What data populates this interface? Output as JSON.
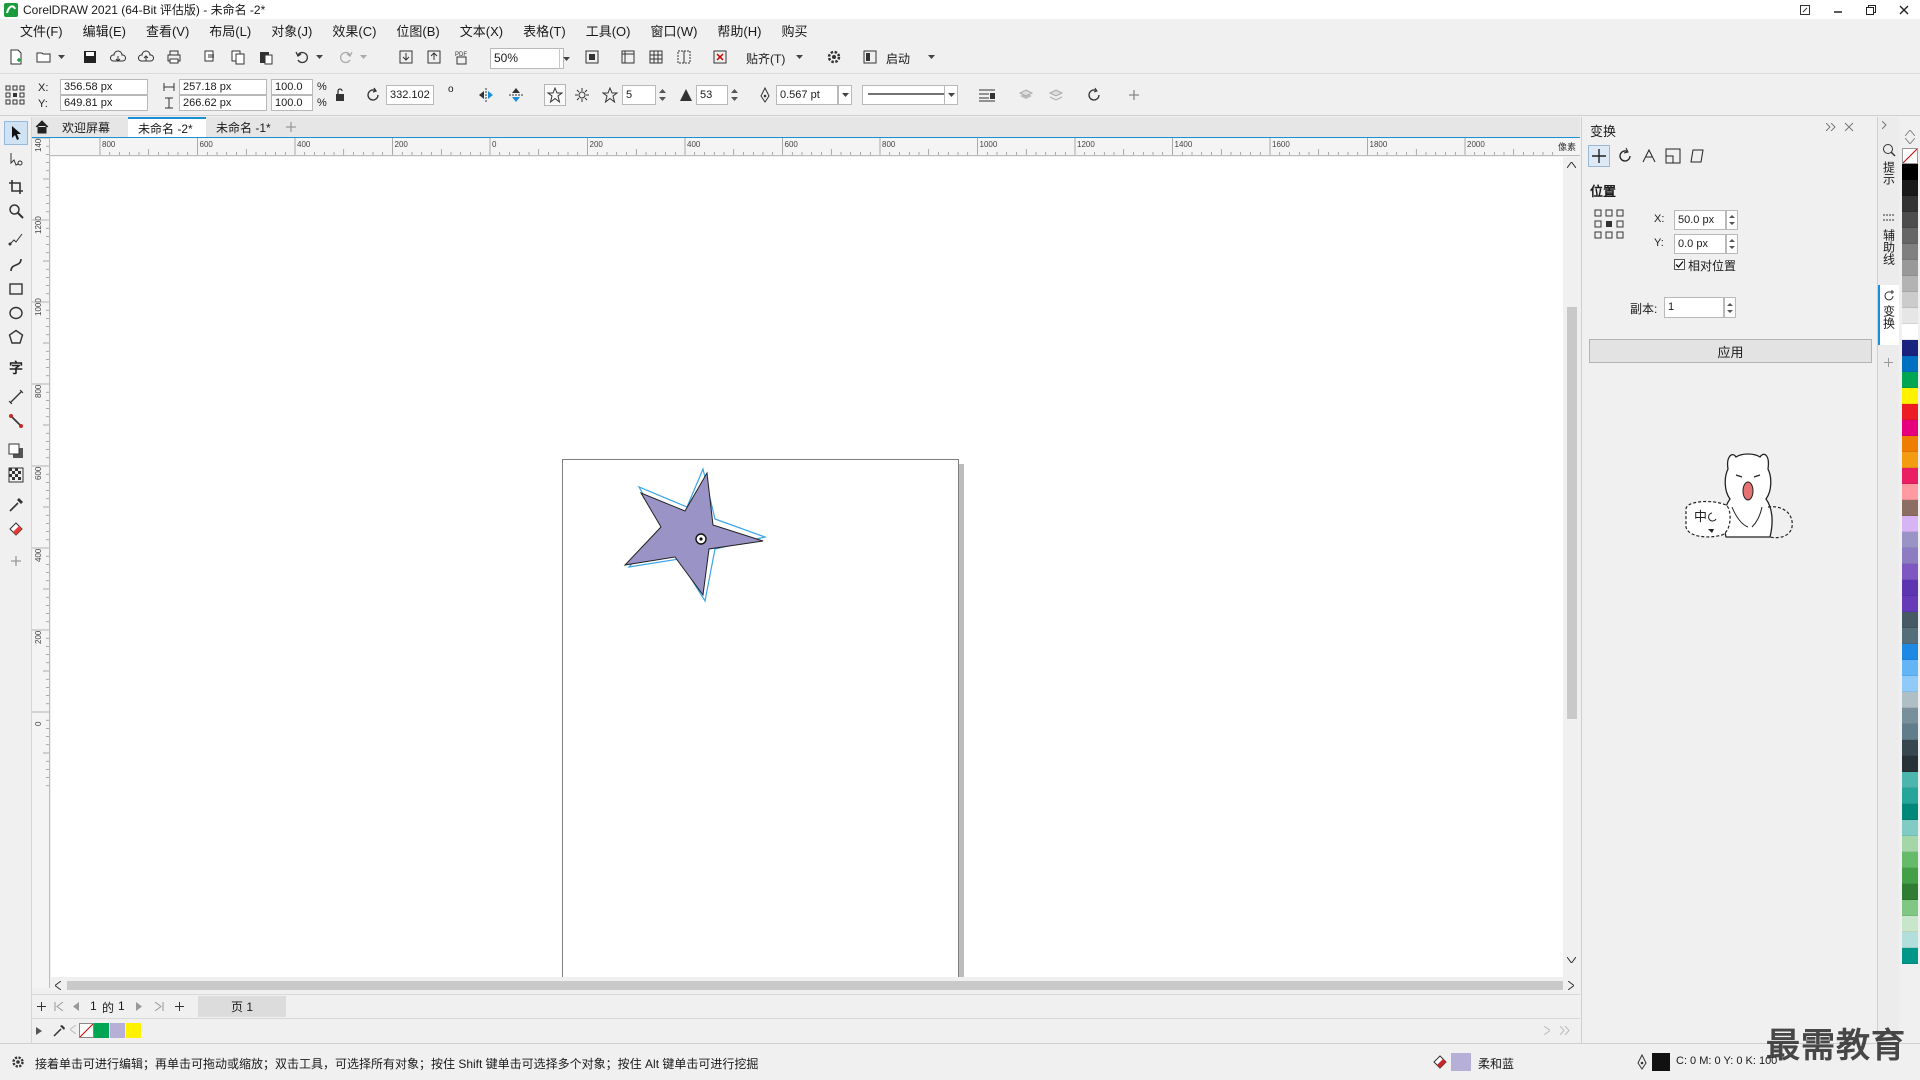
{
  "window": {
    "title": "CorelDRAW 2021 (64-Bit 评估版) - 未命名 -2*"
  },
  "menu": [
    "文件(F)",
    "编辑(E)",
    "查看(V)",
    "布局(L)",
    "对象(J)",
    "效果(C)",
    "位图(B)",
    "文本(X)",
    "表格(T)",
    "工具(O)",
    "窗口(W)",
    "帮助(H)",
    "购买"
  ],
  "toolbar": {
    "zoom": "50%",
    "snap_label": "贴齐(T)",
    "launch_label": "启动"
  },
  "propbar": {
    "x_label": "X:",
    "y_label": "Y:",
    "x": "356.58 px",
    "y": "649.81 px",
    "width": "257.18 px",
    "height": "266.62 px",
    "scale_w": "100.0",
    "scale_h": "100.0",
    "pct": "%",
    "rotation": "332.102",
    "degree": "o",
    "points": "5",
    "sharpness": "53",
    "outline_width": "0.567 pt"
  },
  "tabs": [
    {
      "label": "欢迎屏幕",
      "active": false
    },
    {
      "label": "未命名 -2*",
      "active": true
    },
    {
      "label": "未命名 -1*",
      "active": false
    }
  ],
  "ruler": {
    "unit": "像素",
    "h_ticks": [
      "800",
      "600",
      "400",
      "200",
      "0",
      "200",
      "400",
      "600",
      "800",
      "1000",
      "1200",
      "1400",
      "1600",
      "1800",
      "2000"
    ],
    "v_ticks": [
      "1400",
      "1200",
      "1000",
      "800",
      "600",
      "400",
      "200",
      "0"
    ]
  },
  "pagenav": {
    "current": "1",
    "of": "的",
    "total": "1",
    "page_tab": "页 1"
  },
  "docker": {
    "title": "变换",
    "section": "位置",
    "x_label": "X:",
    "y_label": "Y:",
    "x_value": "50.0 px",
    "y_value": "0.0 px",
    "relative_label": "相对位置",
    "relative_checked": true,
    "copies_label": "副本:",
    "copies_value": "1",
    "apply_label": "应用"
  },
  "side_tabs": [
    "提示",
    "辅助线",
    "变换"
  ],
  "sticker": {
    "text": "中"
  },
  "status": {
    "hint": "接着单击可进行编辑；再单击可拖动或缩放；双击工具，可选择所有对象；按住 Shift 键单击可选择多个对象；按住 Alt 键单击可进行挖掘",
    "fill_name": "柔和蓝",
    "color_readout": "C: 0 M: 0 Y: 0 K: 100"
  },
  "watermark": "最需教育",
  "colors": {
    "star_fill": "#9a93c6",
    "star_outline_copy": "#3aa5e6",
    "accent": "#1b8fd6"
  },
  "palette": [
    "#ffffff",
    "#000000",
    "#1a1a1a",
    "#333333",
    "#4d4d4d",
    "#666666",
    "#808080",
    "#999999",
    "#b3b3b3",
    "#cccccc",
    "#e6e6e6",
    "#ffffff",
    "#1a237e",
    "#0070c0",
    "#00a651",
    "#fff200",
    "#ed1c24",
    "#e6007e",
    "#ef7d00",
    "#f39c12",
    "#e91e63",
    "#ff9aa2",
    "#8d6e63",
    "#d7b4f3",
    "#9a93c6",
    "#8e7cc3",
    "#7e57c2",
    "#5e35b1",
    "#673ab7",
    "#455a64",
    "#546e7a",
    "#1e88e5",
    "#64b5f6",
    "#90caf9",
    "#b0bec5",
    "#78909c",
    "#607d8b",
    "#37474f",
    "#263238",
    "#4db6ac",
    "#26a69a",
    "#00897b",
    "#80cbc4",
    "#a5d6a7",
    "#66bb6a",
    "#43a047",
    "#2e7d32",
    "#81c784",
    "#c8e6c9",
    "#b2dfdb",
    "#009688"
  ]
}
